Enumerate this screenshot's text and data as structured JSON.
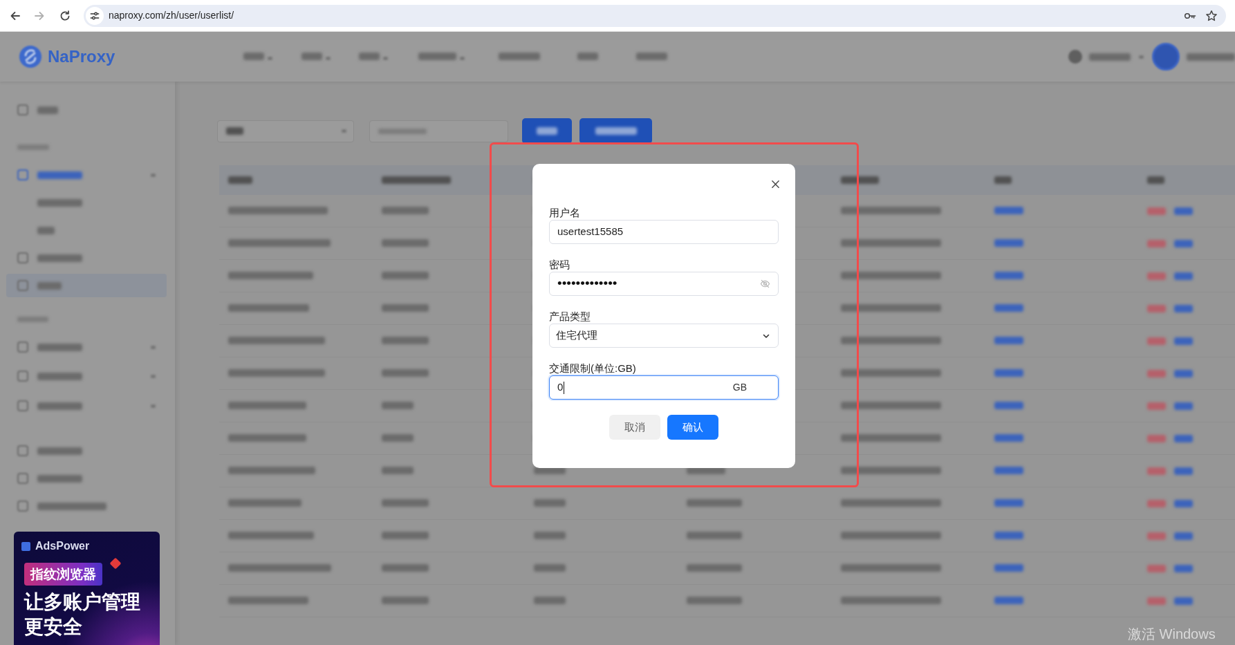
{
  "browser": {
    "url": "naproxy.com/zh/user/userlist/",
    "forward_disabled": true
  },
  "page": {
    "logo": "NaProxy",
    "ad": {
      "brand": "AdsPower",
      "badge": "指纹浏览器",
      "headline": "让多账户管理更安全"
    }
  },
  "dialog": {
    "fields": [
      {
        "kind": "text",
        "label": "用户名",
        "value": "usertest15585",
        "focused": false
      },
      {
        "kind": "password",
        "label": "密码",
        "value": "•••••••••••••",
        "focused": false
      },
      {
        "kind": "select",
        "label": "产品类型",
        "value": "住宅代理",
        "focused": false
      },
      {
        "kind": "unit",
        "label": "交通限制(单位:GB)",
        "value": "0",
        "unit": "GB",
        "focused": true
      }
    ],
    "buttons": [
      {
        "kind": "secondary",
        "label": "取消"
      },
      {
        "kind": "primary",
        "label": "确认"
      }
    ]
  },
  "os_watermark": "激活 Windows"
}
